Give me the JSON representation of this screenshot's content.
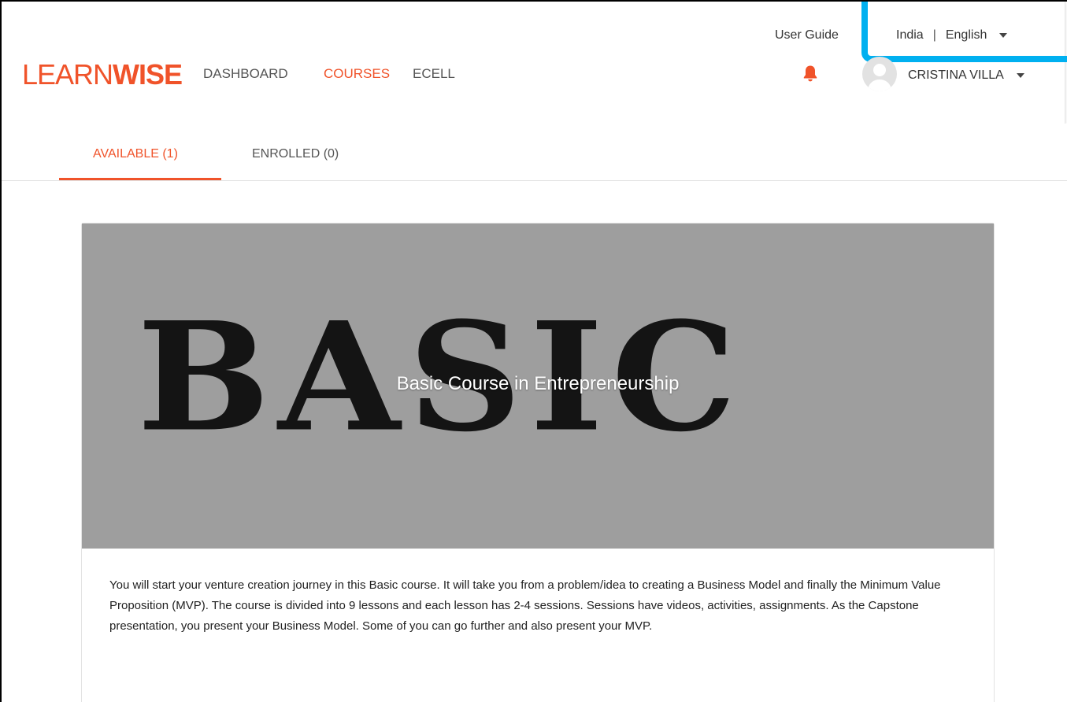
{
  "header": {
    "logo": {
      "prefix": "LEARN",
      "suffix": "WISE"
    },
    "nav": [
      {
        "label": "DASHBOARD"
      },
      {
        "label": "COURSES"
      },
      {
        "label": "ECELL"
      }
    ],
    "user_guide_label": "User Guide",
    "locale": {
      "country": "India",
      "separator": "|",
      "language": "English"
    },
    "notification_icon": "bell-icon",
    "user": {
      "name": "CRISTINA VILLA",
      "avatar_icon": "user-avatar-icon"
    }
  },
  "tabs": [
    {
      "label": "AVAILABLE (1)"
    },
    {
      "label": "ENROLLED (0)"
    }
  ],
  "course": {
    "hero_word": "BASIC",
    "title": "Basic Course in Entrepreneurship",
    "description": "You will start your venture creation journey in this Basic course. It will take you from a problem/idea to creating a Business Model and finally the Minimum Value Proposition (MVP). The course is divided into 9 lessons and each lesson has 2-4 sessions. Sessions have videos, activities, assignments. As the Capstone presentation, you present your Business Model. Some of you can go further and also present your MVP."
  },
  "colors": {
    "accent": "#f0532a",
    "highlight_box": "#00b0f0",
    "hero_background": "#9e9e9e"
  }
}
